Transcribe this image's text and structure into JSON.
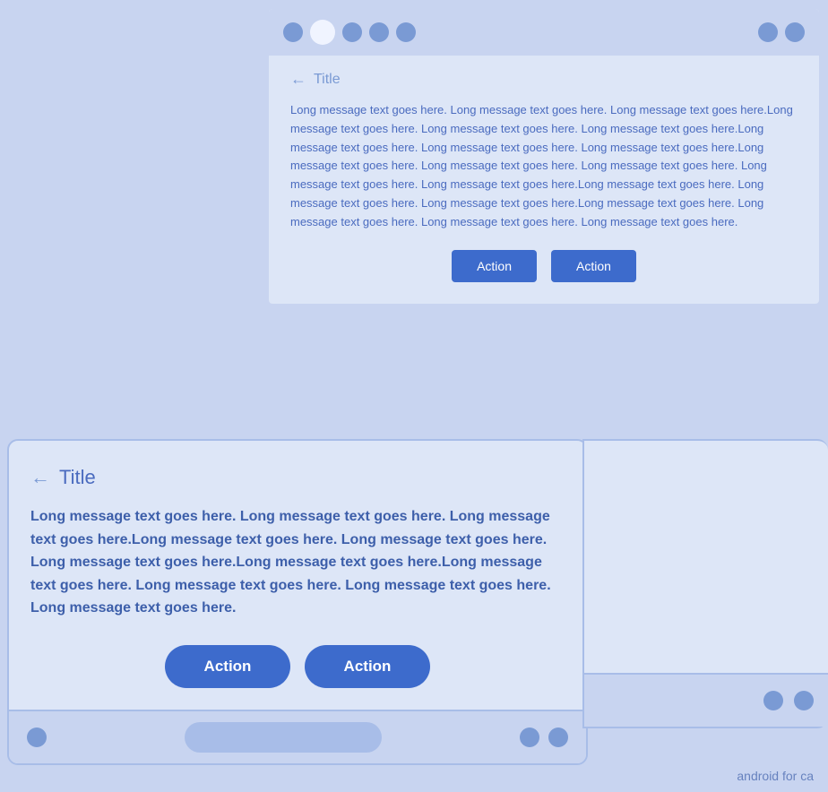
{
  "top_card": {
    "title": "Title",
    "message": "Long message text goes here. Long message text goes here. Long message text goes here.Long message text goes here. Long message text goes here. Long message text goes here.Long message text goes here. Long message text goes here. Long message text goes here.Long message text goes here. Long message text goes here. Long message text goes here. Long message text goes here. Long message text goes here.Long message text goes here. Long message text goes here. Long message text goes here.Long message text goes here. Long message text goes here. Long message text goes here. Long message text goes here.",
    "action1_label": "Action",
    "action2_label": "Action"
  },
  "bottom_card": {
    "title": "Title",
    "message": "Long message text goes here. Long message text goes here. Long message text goes here.Long message text goes here. Long message text goes here. Long message text goes here.Long message text goes here.Long message text goes here. Long message text goes here. Long message text goes here. Long message text goes here.",
    "action1_label": "Action",
    "action2_label": "Action"
  },
  "watermark": "android for ca"
}
